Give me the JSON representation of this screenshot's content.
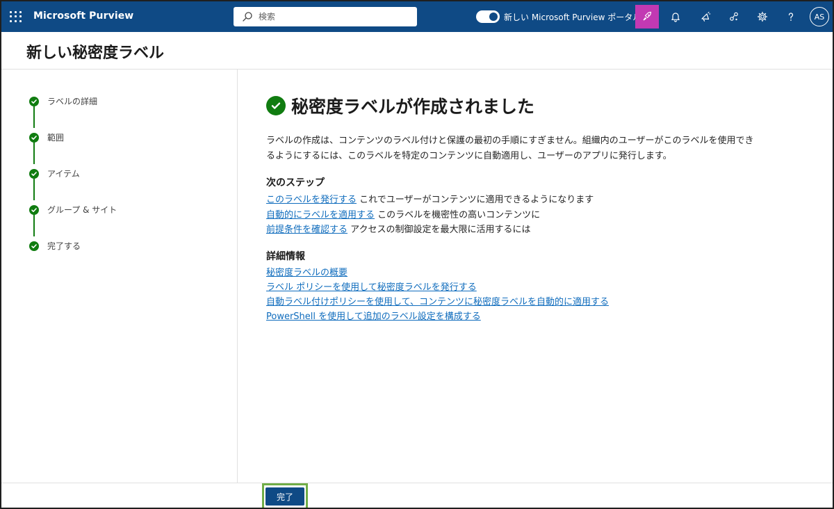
{
  "topbar": {
    "app_title": "Microsoft Purview",
    "search_placeholder": "検索",
    "new_portal_label": "新しい Microsoft Purview ポータル",
    "avatar_initials": "AS"
  },
  "page": {
    "title": "新しい秘密度ラベル"
  },
  "steps": [
    {
      "label": "ラベルの詳細",
      "status": "completed"
    },
    {
      "label": "範囲",
      "status": "completed"
    },
    {
      "label": "アイテム",
      "status": "completed"
    },
    {
      "label": "グループ & サイト",
      "status": "completed"
    },
    {
      "label": "完了する",
      "status": "completed"
    }
  ],
  "main": {
    "success_title": "秘密度ラベルが作成されました",
    "description_line1": "ラベルの作成は、コンテンツのラベル付けと保護の最初の手順にすぎません。組織内のユーザーがこのラベルを使用でき",
    "description_line2": "るようにするには、このラベルを特定のコンテンツに自動適用し、ユーザーのアプリに発行します。",
    "next_steps_heading": "次のステップ",
    "next_steps": [
      {
        "link": "このラベルを発行する",
        "text": " これでユーザーがコンテンツに適用できるようになります"
      },
      {
        "link": "自動的にラベルを適用する",
        "text": " このラベルを機密性の高いコンテンツに"
      },
      {
        "link": "前提条件を確認する",
        "text": " アクセスの制御設定を最大限に活用するには"
      }
    ],
    "more_info_heading": "詳細情報",
    "more_info_links": [
      "秘密度ラベルの概要",
      "ラベル ポリシーを使用して秘密度ラベルを発行する",
      "自動ラベル付けポリシーを使用して、コンテンツに秘密度ラベルを自動的に適用する",
      "PowerShell を使用して追加のラベル設定を構成する"
    ]
  },
  "footer": {
    "done_label": "完了"
  },
  "colors": {
    "topbar": "#0f4a85",
    "success_green": "#107c10",
    "link": "#0f6cbd",
    "active_icon_bg": "#c239b3",
    "highlight_outline": "#70ad47"
  },
  "icons": {
    "waffle": "waffle-icon",
    "search": "search-icon",
    "active_app": "rocket-icon",
    "notifications": "bell-icon",
    "whats_new": "megaphone-icon",
    "connections": "share-icon",
    "settings": "gear-icon",
    "help": "help-icon"
  }
}
